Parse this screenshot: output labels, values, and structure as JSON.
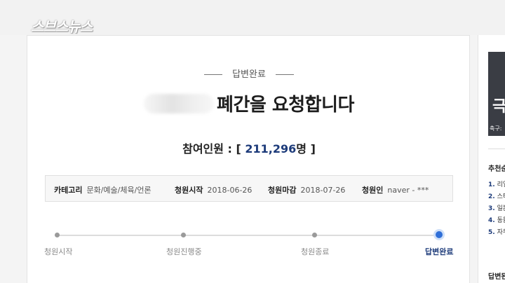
{
  "watermark": "스브스뉴스",
  "petition": {
    "status": "답변완료",
    "title": "폐간을 요청합니다",
    "participants_label": "참여인원 : [",
    "participants_count": "211,296",
    "participants_unit": "명 ]",
    "info": {
      "category_label": "카테고리",
      "category_value": "문화/예술/체육/언론",
      "start_label": "청원시작",
      "start_value": "2018-06-26",
      "end_label": "청원마감",
      "end_value": "2018-07-26",
      "author_label": "청원인",
      "author_value": "naver - ***"
    },
    "steps": [
      {
        "label": "청원시작",
        "active": false
      },
      {
        "label": "청원진행중",
        "active": false
      },
      {
        "label": "청원종료",
        "active": false
      },
      {
        "label": "답변완료",
        "active": true
      }
    ]
  },
  "sidebar": {
    "thumb_text": "극",
    "thumb_caption": "축구:",
    "recommend_title": "추천순",
    "items": [
      {
        "num": "1.",
        "text": "리얼"
      },
      {
        "num": "2.",
        "text": "스티"
      },
      {
        "num": "3.",
        "text": "일본"
      },
      {
        "num": "4.",
        "text": "동물"
      },
      {
        "num": "5.",
        "text": "자두"
      }
    ],
    "answered_title": "답변된"
  },
  "colors": {
    "accent": "#2f6fd8",
    "count": "#1d3b7a"
  }
}
